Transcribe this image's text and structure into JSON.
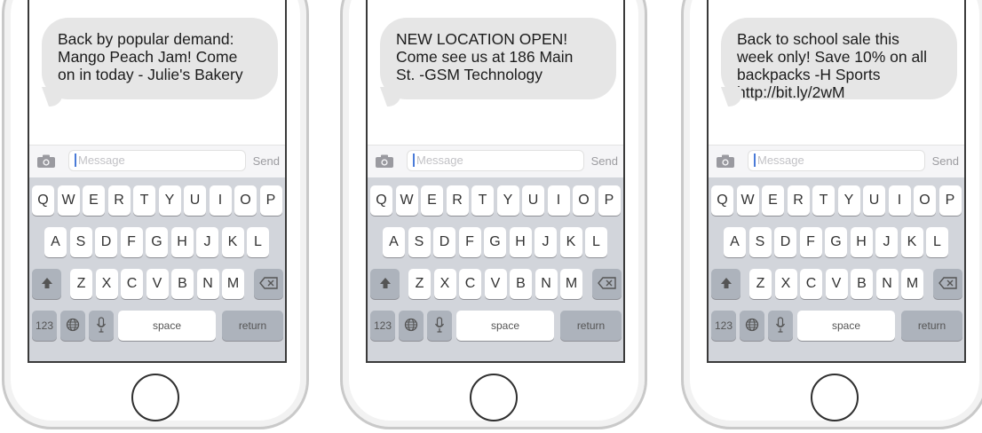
{
  "phones": [
    {
      "message": "Back by popular demand:\nMango Peach Jam! Come\non in today - Julie's Bakery",
      "input": {
        "placeholder": "Message",
        "send_label": "Send"
      }
    },
    {
      "message": "NEW LOCATION OPEN!\nCome see us at 186 Main\nSt. -GSM Technology",
      "input": {
        "placeholder": "Message",
        "send_label": "Send"
      }
    },
    {
      "message": "Back to school sale this\nweek only! Save 10% on all\nbackpacks  -H Sports\n http://bit.ly/2wM",
      "input": {
        "placeholder": "Message",
        "send_label": "Send"
      }
    }
  ],
  "keyboard": {
    "row1": [
      "Q",
      "W",
      "E",
      "R",
      "T",
      "Y",
      "U",
      "I",
      "O",
      "P"
    ],
    "row2": [
      "A",
      "S",
      "D",
      "F",
      "G",
      "H",
      "J",
      "K",
      "L"
    ],
    "row3": [
      "Z",
      "X",
      "C",
      "V",
      "B",
      "N",
      "M"
    ],
    "numbers_label": "123",
    "space_label": "space",
    "return_label": "return",
    "icons": {
      "shift": "shift-icon",
      "backspace": "backspace-icon",
      "globe": "globe-icon",
      "mic": "microphone-icon",
      "camera": "camera-icon"
    }
  },
  "colors": {
    "bubble": "#e6e6e6",
    "keyboard_bg": "#d2d5db",
    "key": "#ffffff",
    "dark_key": "#adb3bc",
    "caret": "#4a7bd8"
  }
}
